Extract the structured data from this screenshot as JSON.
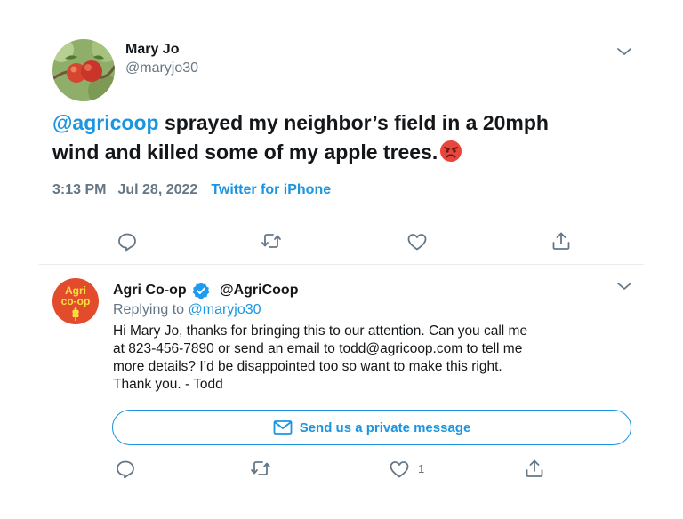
{
  "tweet": {
    "display_name": "Mary Jo",
    "handle": "@maryjo30",
    "mention": "@agricoop",
    "text_line1_rest": " sprayed my neighbor’s field in a 20mph",
    "text_line2": "wind and killed some of my apple trees.",
    "emoji": "angry-face-icon",
    "time": "3:13 PM",
    "date": "Jul 28, 2022",
    "source": "Twitter for iPhone"
  },
  "reply": {
    "display_name": "Agri Co-op",
    "handle": "@AgriCoop",
    "replying_prefix": "Replying to",
    "replying_to": "@maryjo30",
    "lines": [
      "Hi Mary Jo, thanks for bringing this to our attention. Can you call me",
      "at 823-456-7890 or send an email to todd@agricoop.com to tell me",
      "more details? I’d be disappointed too so want to make this right.",
      "Thank you. - Todd"
    ],
    "avatar_text_line1": "Agri",
    "avatar_text_line2": "co-op",
    "dm_button_label": "Send us a private message",
    "like_count": "1"
  },
  "colors": {
    "link": "#1b95e0",
    "secondary_text": "#657786",
    "primary_text": "#14171a",
    "logo_red": "#e24b2c",
    "logo_yellow": "#f5e13c"
  },
  "icons": {
    "more": "chevron-down-icon",
    "reply": "reply-icon",
    "retweet": "retweet-icon",
    "like": "heart-icon",
    "share": "share-icon",
    "verified": "verified-badge-icon",
    "mail": "mail-icon"
  }
}
